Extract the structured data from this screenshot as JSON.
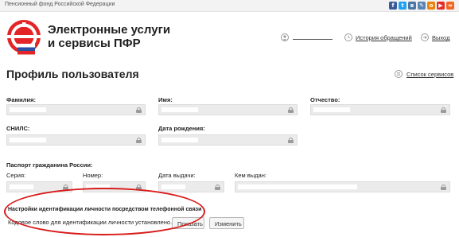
{
  "topbar": {
    "org": "Пенсионный фонд Российской Федерации"
  },
  "social": [
    {
      "name": "facebook-icon",
      "glyph": "f",
      "color": "#3b5998"
    },
    {
      "name": "twitter-icon",
      "glyph": "t",
      "color": "#1da1f2"
    },
    {
      "name": "vk-icon",
      "glyph": "в",
      "color": "#4c75a3"
    },
    {
      "name": "livejournal-icon",
      "glyph": "✎",
      "color": "#5a86b5"
    },
    {
      "name": "odnoklassniki-icon",
      "glyph": "o",
      "color": "#ee8208"
    },
    {
      "name": "youtube-icon",
      "glyph": "▶",
      "color": "#e52d27"
    },
    {
      "name": "rss-icon",
      "glyph": "≈",
      "color": "#f26522"
    }
  ],
  "brand": {
    "line1": "Электронные услуги",
    "line2": "и сервисы ПФР"
  },
  "header": {
    "history": "История обращений",
    "logout": "Выход"
  },
  "page": {
    "title": "Профиль пользователя",
    "services_link": "Список сервисов"
  },
  "fields": {
    "surname": "Фамилия:",
    "name": "Имя:",
    "patronymic": "Отчество:",
    "snils": "СНИЛС:",
    "birthdate": "Дата рождения:"
  },
  "passport": {
    "title": "Паспорт гражданина России:",
    "series": "Серия:",
    "number": "Номер:",
    "issue_date": "Дата выдачи:",
    "issued_by": "Кем выдан:"
  },
  "phone_settings": {
    "title": "Настройки идентификации личности посредством телефонной связи",
    "status": "Кодовое слово для идентификации личности установлено.",
    "show_button": "Показать",
    "change_button": "Изменить"
  }
}
